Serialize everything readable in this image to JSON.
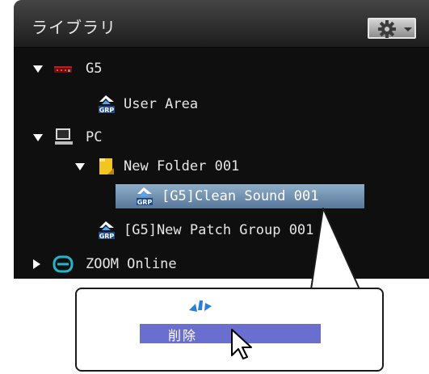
{
  "panel": {
    "title": "ライブラリ",
    "gear_menu_icon": "gear-icon"
  },
  "tree": {
    "items": [
      {
        "label": "G5",
        "icon": "g5-device-icon",
        "expanded": true
      },
      {
        "label": "User Area",
        "icon": "grp-patch-group-icon"
      },
      {
        "label": "PC",
        "icon": "computer-icon",
        "expanded": true
      },
      {
        "label": "New Folder 001",
        "icon": "folder-icon",
        "expanded": true
      },
      {
        "label": "[G5]Clean Sound 001",
        "icon": "grp-patch-group-icon",
        "selected": true
      },
      {
        "label": "[G5]New Patch Group 001",
        "icon": "grp-patch-group-icon"
      },
      {
        "label": "ZOOM Online",
        "icon": "zoom-online-icon",
        "expanded": false
      }
    ]
  },
  "context_menu": {
    "items": [
      {
        "label": "削除",
        "highlighted": true
      }
    ]
  },
  "colors": {
    "panel_background": "#0f0f0f",
    "selection": "#6f8fb0",
    "menu_highlight": "#6a6ecf",
    "zoom_icon": "#1fb7c9",
    "folder": "#f2c521"
  }
}
